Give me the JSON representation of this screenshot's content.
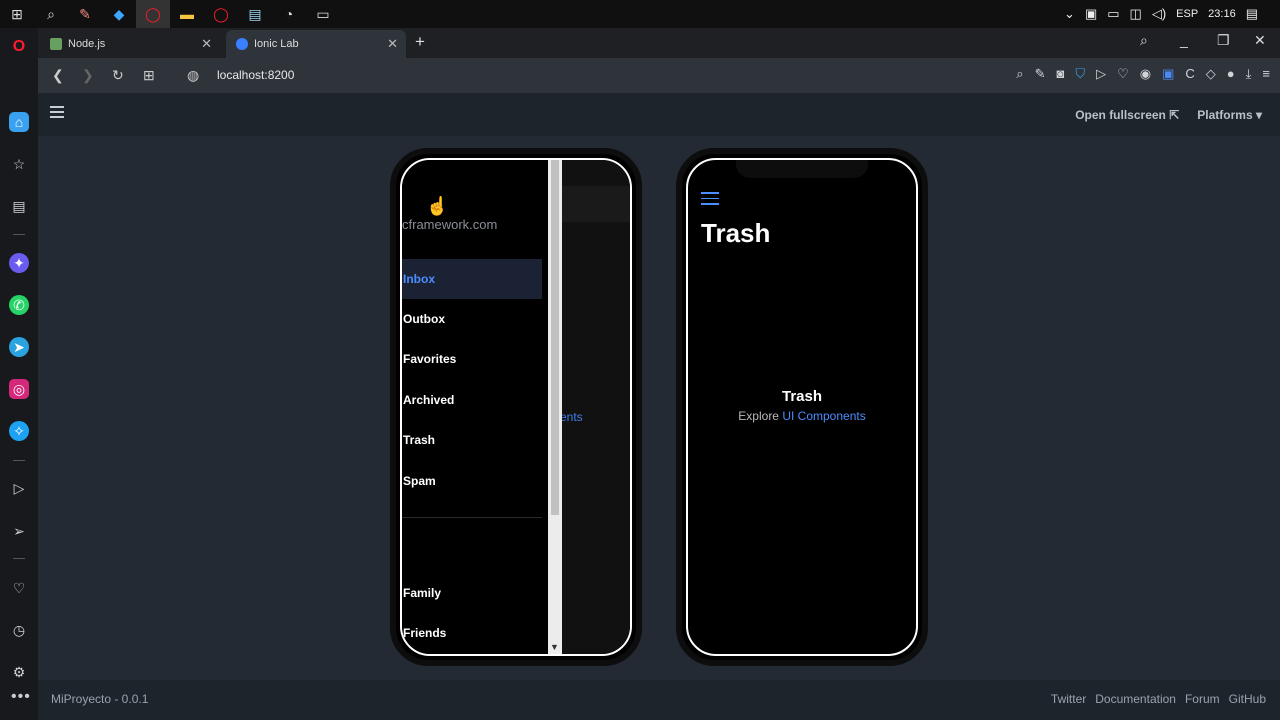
{
  "taskbar": {
    "lang": "ESP",
    "time": "23:16"
  },
  "tabs": [
    {
      "label": "Node.js",
      "favicon_color": "#68a063"
    },
    {
      "label": "Ionic Lab",
      "favicon_color": "#3880ff"
    }
  ],
  "address": {
    "url": "localhost:8200"
  },
  "lab": {
    "open_fullscreen": "Open fullscreen",
    "platforms": "Platforms"
  },
  "left_phone": {
    "menu_subtitle": "cframework.com",
    "menu_items": [
      "Inbox",
      "Outbox",
      "Favorites",
      "Archived",
      "Trash",
      "Spam"
    ],
    "label_items": [
      "Family",
      "Friends"
    ],
    "behind_link": "ents"
  },
  "right_phone": {
    "title": "Trash",
    "container_heading": "Trash",
    "explore_text": "Explore",
    "explore_link": "UI Components"
  },
  "footer": {
    "project": "MiProyecto - 0.0.1",
    "links": [
      "Twitter",
      "Documentation",
      "Forum",
      "GitHub"
    ]
  },
  "colors": {
    "accent": "#4c8dff",
    "background": "#232a33"
  }
}
